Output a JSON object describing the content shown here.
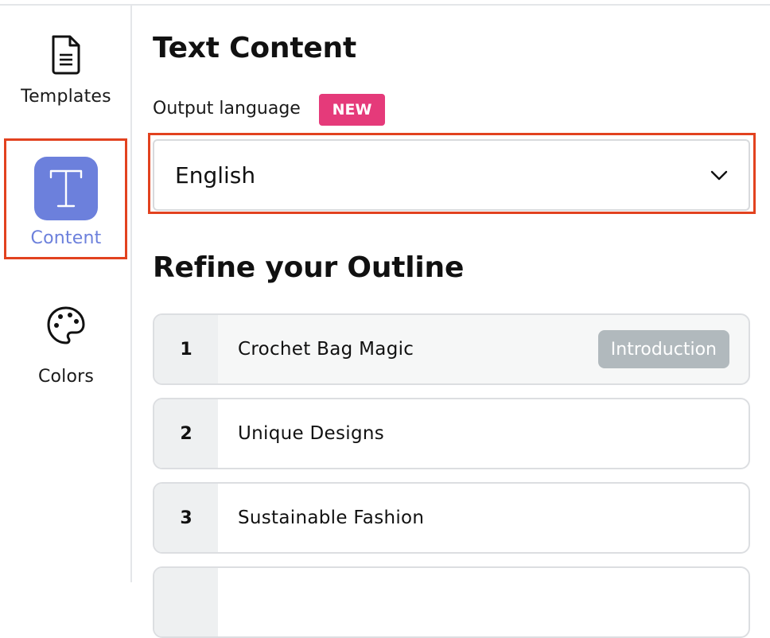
{
  "sidebar": {
    "items": [
      {
        "label": "Templates",
        "icon": "document-icon"
      },
      {
        "label": "Content",
        "icon": "text-t-icon",
        "active": true
      },
      {
        "label": "Colors",
        "icon": "palette-icon"
      }
    ]
  },
  "main": {
    "title": "Text Content",
    "language_label": "Output language",
    "new_badge": "NEW",
    "language_select": {
      "value": "English"
    },
    "outline_title": "Refine your Outline",
    "outline": [
      {
        "number": "1",
        "text": "Crochet Bag Magic",
        "tag": "Introduction"
      },
      {
        "number": "2",
        "text": "Unique Designs"
      },
      {
        "number": "3",
        "text": "Sustainable Fashion"
      }
    ]
  },
  "colors": {
    "accent": "#6c80dc",
    "badge": "#e53a7a",
    "highlight": "#e2421f",
    "tag": "#b1b9bd"
  }
}
